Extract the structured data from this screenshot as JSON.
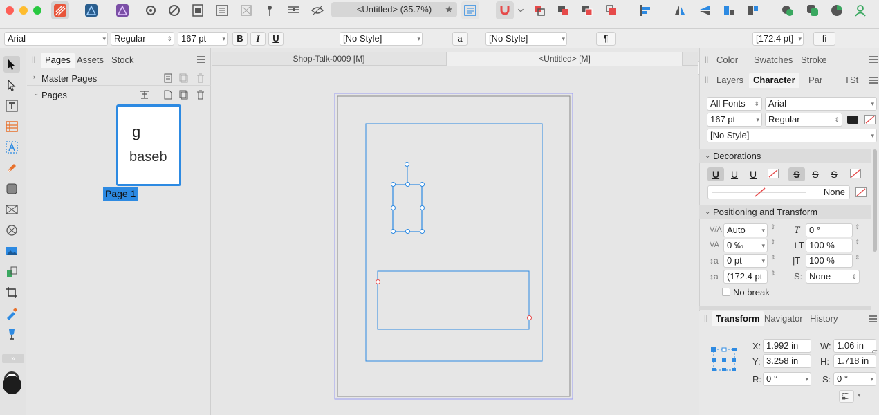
{
  "toolbar": {
    "doc_title": "<Untitled> (35.7%)",
    "pin_glyph": "★"
  },
  "context": {
    "font": "Arial",
    "weight": "Regular",
    "size": "167 pt",
    "bold": "B",
    "italic": "I",
    "underline": "U",
    "char_style_icon": "a",
    "char_style": "[No Style]",
    "para_style_icon": "a",
    "pilcrow": "¶",
    "para_style": "[No Style]",
    "pilcrow2": "¶",
    "leading": "[172.4 pt]",
    "ligature": "fi",
    "overflow": "»"
  },
  "left_panel": {
    "tabs": [
      "Pages",
      "Assets",
      "Stock"
    ],
    "master_pages": "Master Pages",
    "pages": "Pages",
    "thumb_line1": "g",
    "thumb_line2": "baseb",
    "page_label": "Page 1"
  },
  "doc_tabs": [
    "Shop-Talk-0009 [M]",
    "<Untitled> [M]"
  ],
  "right_panel": {
    "top_tabs": [
      "Color",
      "Swatches",
      "Stroke"
    ],
    "second_tabs": [
      "Layers",
      "Character",
      "Par",
      "TSt"
    ],
    "font_collection": "All Fonts",
    "font": "Arial",
    "size": "167 pt",
    "weight": "Regular",
    "style": "[No Style]",
    "decorations_title": "Decorations",
    "deco_u1": "U",
    "deco_u2": "U",
    "deco_u3": "U",
    "deco_s1": "S",
    "deco_s2": "S",
    "deco_s3": "S",
    "deco_none": "None",
    "pos_title": "Positioning and Transform",
    "kerning": "Auto",
    "tracking": "0 ‰",
    "baseline": "0 pt",
    "leading": "(172.4 pt",
    "shear": "0 °",
    "vscale": "100 %",
    "hscale": "100 %",
    "script": "None",
    "no_break": "No break",
    "bottom_tabs": [
      "Transform",
      "Navigator",
      "History"
    ],
    "x_label": "X:",
    "x": "1.992 in",
    "y_label": "Y:",
    "y": "3.258 in",
    "w_label": "W:",
    "w": "1.06 in",
    "h_label": "H:",
    "h": "1.718 in",
    "r_label": "R:",
    "r": "0 °",
    "s_label": "S:",
    "s": "0 °"
  },
  "colors": {
    "accent": "#2d8ae2",
    "selection": "#2d8ae2",
    "red": "#e64a4a"
  }
}
